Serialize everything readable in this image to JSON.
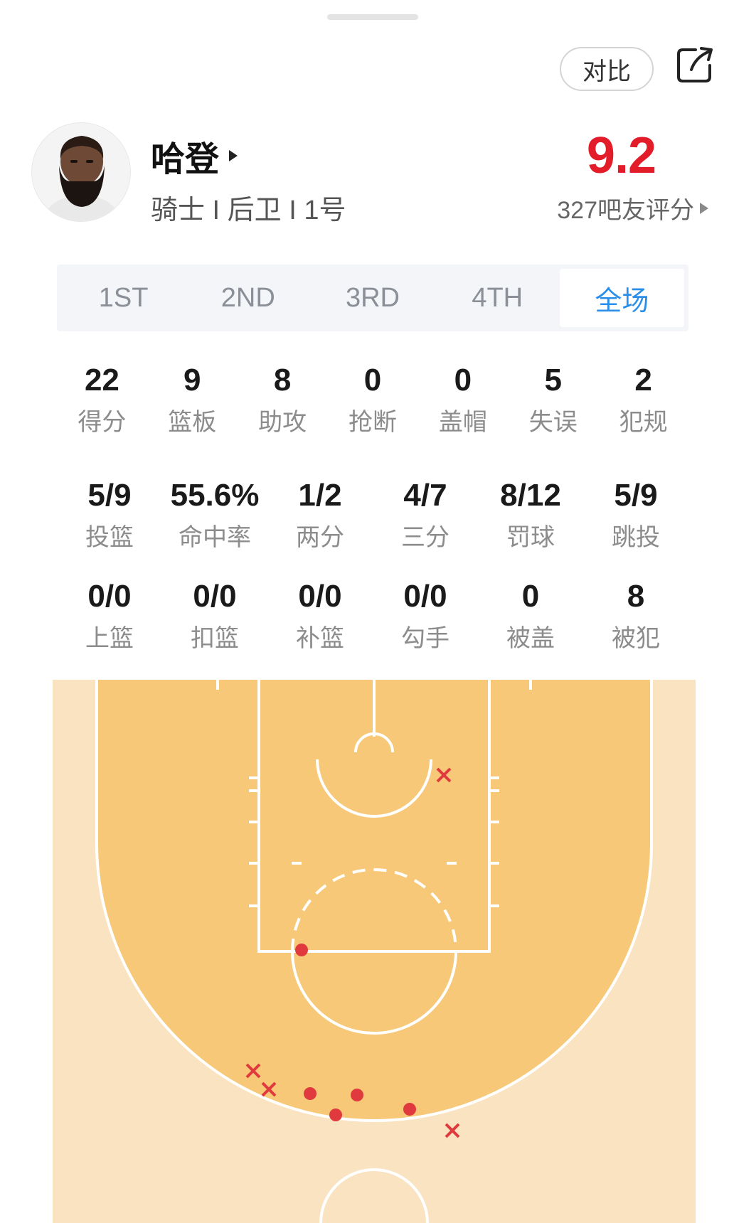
{
  "header": {
    "compare_label": "对比"
  },
  "icons": {
    "share": "share-icon",
    "name_arrow": "triangle-right-icon",
    "rating_arrow": "triangle-right-icon"
  },
  "player": {
    "name": "哈登",
    "meta": "骑士 I 后卫 I 1号"
  },
  "rating": {
    "score": "9.2",
    "count_label": "327吧友评分",
    "color": "#e31c2a"
  },
  "tabs": [
    {
      "label": "1ST",
      "active": false
    },
    {
      "label": "2ND",
      "active": false
    },
    {
      "label": "3RD",
      "active": false
    },
    {
      "label": "4TH",
      "active": false
    },
    {
      "label": "全场",
      "active": true
    }
  ],
  "accent_color": "#2b8fea",
  "stats_row1": [
    {
      "value": "22",
      "label": "得分"
    },
    {
      "value": "9",
      "label": "篮板"
    },
    {
      "value": "8",
      "label": "助攻"
    },
    {
      "value": "0",
      "label": "抢断"
    },
    {
      "value": "0",
      "label": "盖帽"
    },
    {
      "value": "5",
      "label": "失误"
    },
    {
      "value": "2",
      "label": "犯规"
    }
  ],
  "stats_row2": [
    {
      "value": "5/9",
      "label": "投篮"
    },
    {
      "value": "55.6%",
      "label": "命中率"
    },
    {
      "value": "1/2",
      "label": "两分"
    },
    {
      "value": "4/7",
      "label": "三分"
    },
    {
      "value": "8/12",
      "label": "罚球"
    },
    {
      "value": "5/9",
      "label": "跳投"
    }
  ],
  "stats_row3": [
    {
      "value": "0/0",
      "label": "上篮"
    },
    {
      "value": "0/0",
      "label": "扣篮"
    },
    {
      "value": "0/0",
      "label": "补篮"
    },
    {
      "value": "0/0",
      "label": "勾手"
    },
    {
      "value": "0",
      "label": "被盖"
    },
    {
      "value": "8",
      "label": "被犯"
    }
  ],
  "shot_chart": {
    "made_color": "#e03a3e",
    "missed_color": "#e03a3e",
    "court_colors": {
      "inside": "#f6c877",
      "outside": "#f9e3c1",
      "lines": "#ffffff"
    },
    "shots": [
      {
        "result": "missed"
      },
      {
        "result": "made"
      },
      {
        "result": "missed"
      },
      {
        "result": "missed"
      },
      {
        "result": "made"
      },
      {
        "result": "made"
      },
      {
        "result": "made"
      },
      {
        "result": "made"
      },
      {
        "result": "missed"
      }
    ]
  }
}
